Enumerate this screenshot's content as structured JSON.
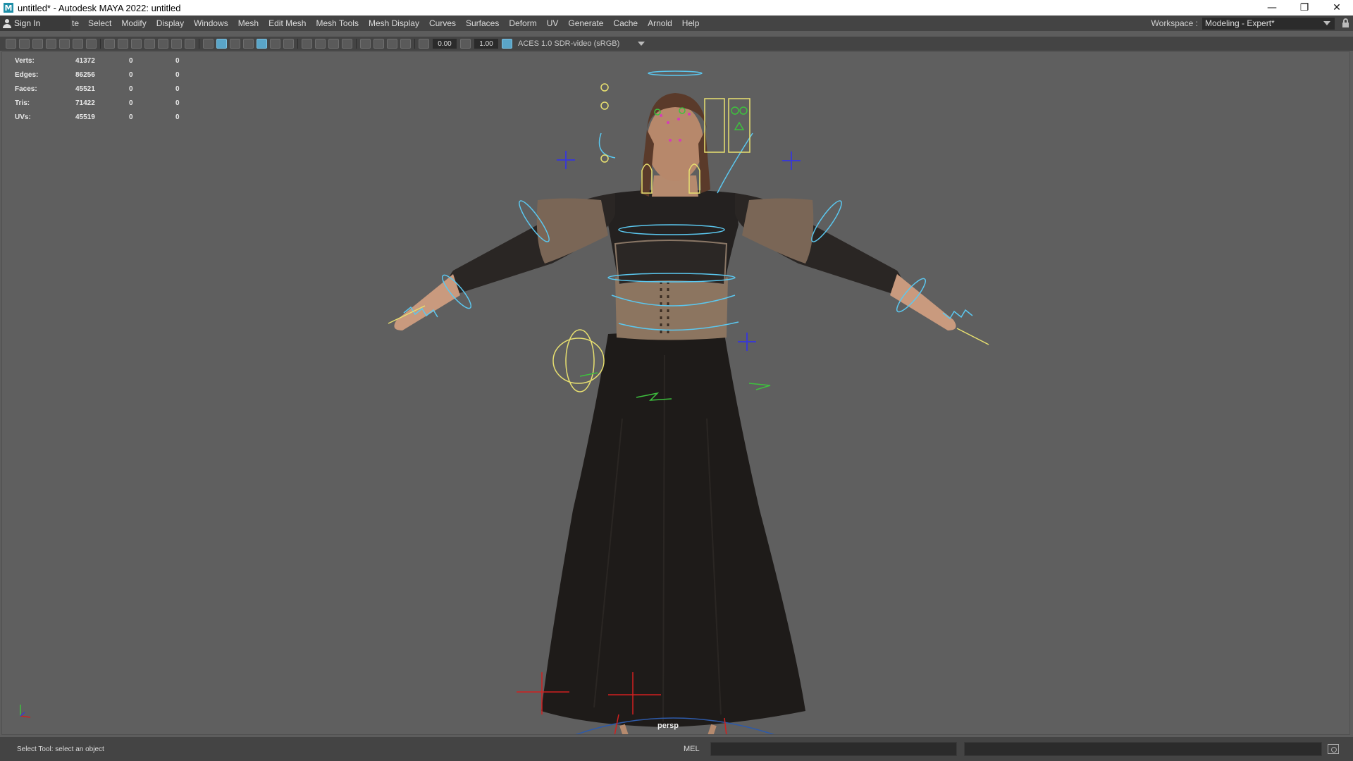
{
  "window": {
    "title": "untitled* - Autodesk MAYA 2022: untitled",
    "icon_letter": "M",
    "controls": {
      "minimize": "—",
      "restore": "❐",
      "close": "✕"
    }
  },
  "menubar": {
    "sign_in": "Sign In",
    "cut_label": "te",
    "items": [
      "Select",
      "Modify",
      "Display",
      "Windows",
      "Mesh",
      "Edit Mesh",
      "Mesh Tools",
      "Mesh Display",
      "Curves",
      "Surfaces",
      "Deform",
      "UV",
      "Generate",
      "Cache",
      "Arnold",
      "Help"
    ],
    "workspace_label": "Workspace :",
    "workspace_value": "Modeling - Expert*"
  },
  "panel_toolbar": {
    "exposure": "0.00",
    "gamma": "1.00",
    "color_management": "ACES 1.0 SDR-video (sRGB)"
  },
  "hud": {
    "rows": [
      {
        "label": "Verts:",
        "v1": "41372",
        "v2": "0",
        "v3": "0"
      },
      {
        "label": "Edges:",
        "v1": "86256",
        "v2": "0",
        "v3": "0"
      },
      {
        "label": "Faces:",
        "v1": "45521",
        "v2": "0",
        "v3": "0"
      },
      {
        "label": "Tris:",
        "v1": "71422",
        "v2": "0",
        "v3": "0"
      },
      {
        "label": "UVs:",
        "v1": "45519",
        "v2": "0",
        "v3": "0"
      }
    ]
  },
  "viewport": {
    "camera": "persp"
  },
  "statusbar": {
    "message": "Select Tool: select an object",
    "mel_label": "MEL"
  },
  "colors": {
    "viewport_bg": "#5f5f5f",
    "ui_bg": "#444444",
    "control_cyan": "#5bc8f0",
    "control_yellow": "#e8e070",
    "control_green": "#3ec03e",
    "control_blue": "#3a3ad0",
    "control_red": "#d02020"
  }
}
